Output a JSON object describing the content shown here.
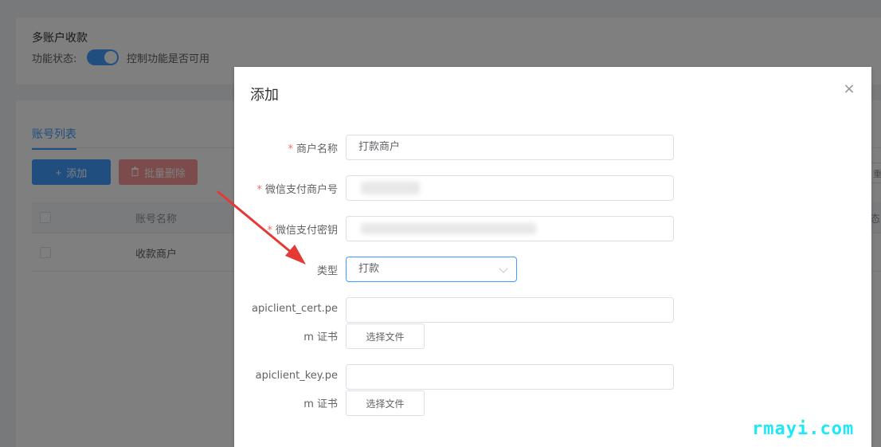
{
  "settings": {
    "title": "多账户收款",
    "status_label": "功能状态:",
    "status_desc": "控制功能是否可用",
    "switch_on": true
  },
  "list": {
    "tab_label": "账号列表",
    "add_label": "添加",
    "batch_delete_label": "批量删除",
    "column_name": "账号名称",
    "right_stub_text": "重",
    "right_column_stub": "态",
    "rows": [
      {
        "name": "收款商户"
      }
    ]
  },
  "dialog": {
    "title": "添加",
    "close_glyph": "×",
    "fields": {
      "merchant_name_label": "商户名称",
      "merchant_name_value": "打款商户",
      "wechat_mchid_label": "微信支付商户号",
      "wechat_key_label": "微信支付密钥",
      "type_label": "类型",
      "type_value": "打款",
      "cert_label_line1": "apiclient_cert.pe",
      "cert_label_line2": "m 证书",
      "key_label_line1": "apiclient_key.pe",
      "key_label_line2": "m 证书",
      "choose_file_label": "选择文件"
    },
    "required_mark": "*"
  },
  "colors": {
    "primary": "#409eff",
    "danger_light": "#f89898",
    "arrow": "#e53935",
    "watermark": "#1de9f6"
  },
  "watermark": "rmayi.com"
}
